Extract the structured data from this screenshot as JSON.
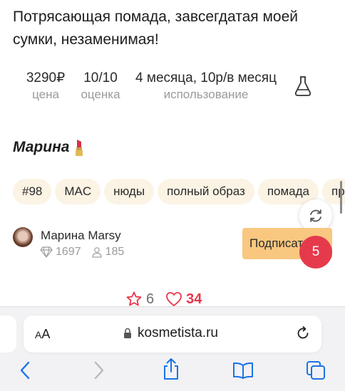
{
  "review": {
    "text": "Потрясающая помада, завсегдатая моей сумки, незаменимая!"
  },
  "stats": {
    "price_value": "3290₽",
    "price_label": "цена",
    "rating_value": "10/10",
    "rating_label": "оценка",
    "usage_value": "4 месяца, 10р/в месяц",
    "usage_label": "использование",
    "flask_icon": "flask-icon"
  },
  "author": {
    "title": "Марина",
    "emoji_icon": "lipstick-icon"
  },
  "tags": [
    "#98",
    "MAC",
    "нюды",
    "полный образ",
    "помада",
    "проф"
  ],
  "user": {
    "name": "Марина Marsy",
    "diamonds": "1697",
    "followers": "185",
    "subscribe_label": "Подписаться"
  },
  "notifications": {
    "count": "5"
  },
  "reactions": {
    "stars": "6",
    "likes": "34"
  },
  "browser": {
    "aa_big": "A",
    "aa_small": "A",
    "url": "kosmetista.ru"
  },
  "colors": {
    "tag_bg": "#fbf3e4",
    "subscribe_bg": "#f9c77f",
    "badge_red": "#e53a4c",
    "like_red": "#e8364b",
    "ios_blue": "#1a73e8",
    "muted_gray": "#9a9a9a"
  }
}
